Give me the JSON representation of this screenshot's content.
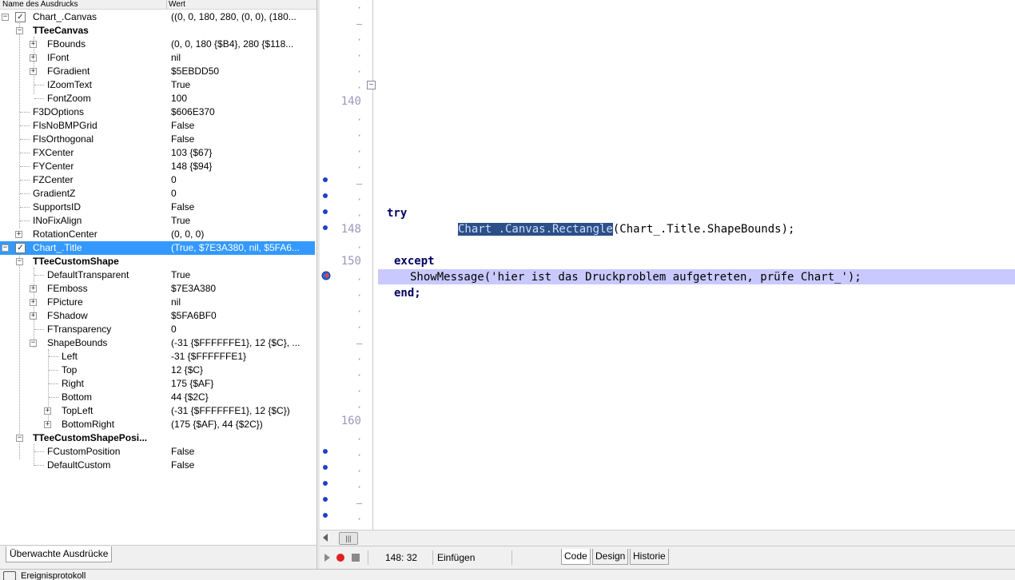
{
  "watch": {
    "header": {
      "name_col": "Name des Ausdrucks",
      "value_col": "Wert"
    },
    "rows": [
      {
        "name": "Chart_.Canvas",
        "value": "((0, 0, 180, 280, (0, 0), (180..."
      },
      {
        "name": "TTeeCanvas",
        "value": ""
      },
      {
        "name": "FBounds",
        "value": "(0, 0, 180 {$B4}, 280 {$118..."
      },
      {
        "name": "IFont",
        "value": "nil"
      },
      {
        "name": "FGradient",
        "value": "$5EBDD50"
      },
      {
        "name": "IZoomText",
        "value": "True"
      },
      {
        "name": "FontZoom",
        "value": "100"
      },
      {
        "name": "F3DOptions",
        "value": "$606E370"
      },
      {
        "name": "FIsNoBMPGrid",
        "value": "False"
      },
      {
        "name": "FIsOrthogonal",
        "value": "False"
      },
      {
        "name": "FXCenter",
        "value": "103 {$67}"
      },
      {
        "name": "FYCenter",
        "value": "148 {$94}"
      },
      {
        "name": "FZCenter",
        "value": "0"
      },
      {
        "name": "GradientZ",
        "value": "0"
      },
      {
        "name": "SupportsID",
        "value": "False"
      },
      {
        "name": "INoFixAlign",
        "value": "True"
      },
      {
        "name": "RotationCenter",
        "value": "(0, 0, 0)"
      },
      {
        "name": "Chart_.Title",
        "value": "(True, $7E3A380, nil, $5FA6..."
      },
      {
        "name": "TTeeCustomShape",
        "value": ""
      },
      {
        "name": "DefaultTransparent",
        "value": "True"
      },
      {
        "name": "FEmboss",
        "value": "$7E3A380"
      },
      {
        "name": "FPicture",
        "value": "nil"
      },
      {
        "name": "FShadow",
        "value": "$5FA6BF0"
      },
      {
        "name": "FTransparency",
        "value": "0"
      },
      {
        "name": "ShapeBounds",
        "value": "(-31 {$FFFFFFE1}, 12 {$C}, ..."
      },
      {
        "name": "Left",
        "value": "-31 {$FFFFFFE1}"
      },
      {
        "name": "Top",
        "value": "12 {$C}"
      },
      {
        "name": "Right",
        "value": "175 {$AF}"
      },
      {
        "name": "Bottom",
        "value": "44 {$2C}"
      },
      {
        "name": "TopLeft",
        "value": "(-31 {$FFFFFFE1}, 12 {$C})"
      },
      {
        "name": "BottomRight",
        "value": "(175 {$AF}, 44 {$2C})"
      },
      {
        "name": "TTeeCustomShapePosi...",
        "value": ""
      },
      {
        "name": "FCustomPosition",
        "value": "False"
      },
      {
        "name": "DefaultCustom",
        "value": "False"
      }
    ],
    "tab_label": "Überwachte Ausdrücke"
  },
  "event_bar": {
    "label": "Ereignisprotokoll"
  },
  "editor": {
    "line_numbers": [
      "140",
      "148",
      "150",
      "160"
    ],
    "code": {
      "try_kw": "try",
      "selected_text": "Chart .Canvas.Rectangle",
      "call_rest": "(Chart_.Title.ShapeBounds);",
      "except_kw": "except",
      "show_message": "ShowMessage('hier ist das Druckproblem aufgetreten, prüfe Chart_');",
      "end_kw": "end;"
    }
  },
  "status": {
    "cursor_pos": "148: 32",
    "insert_mode": "Einfügen",
    "view_tabs": [
      "Code",
      "Design",
      "Historie"
    ]
  },
  "colors": {
    "selection": "#3399ff",
    "exec_line": "#c9c9ff",
    "code_selection": "#2b4f86",
    "breakpoint_dot": "#2040c8"
  }
}
